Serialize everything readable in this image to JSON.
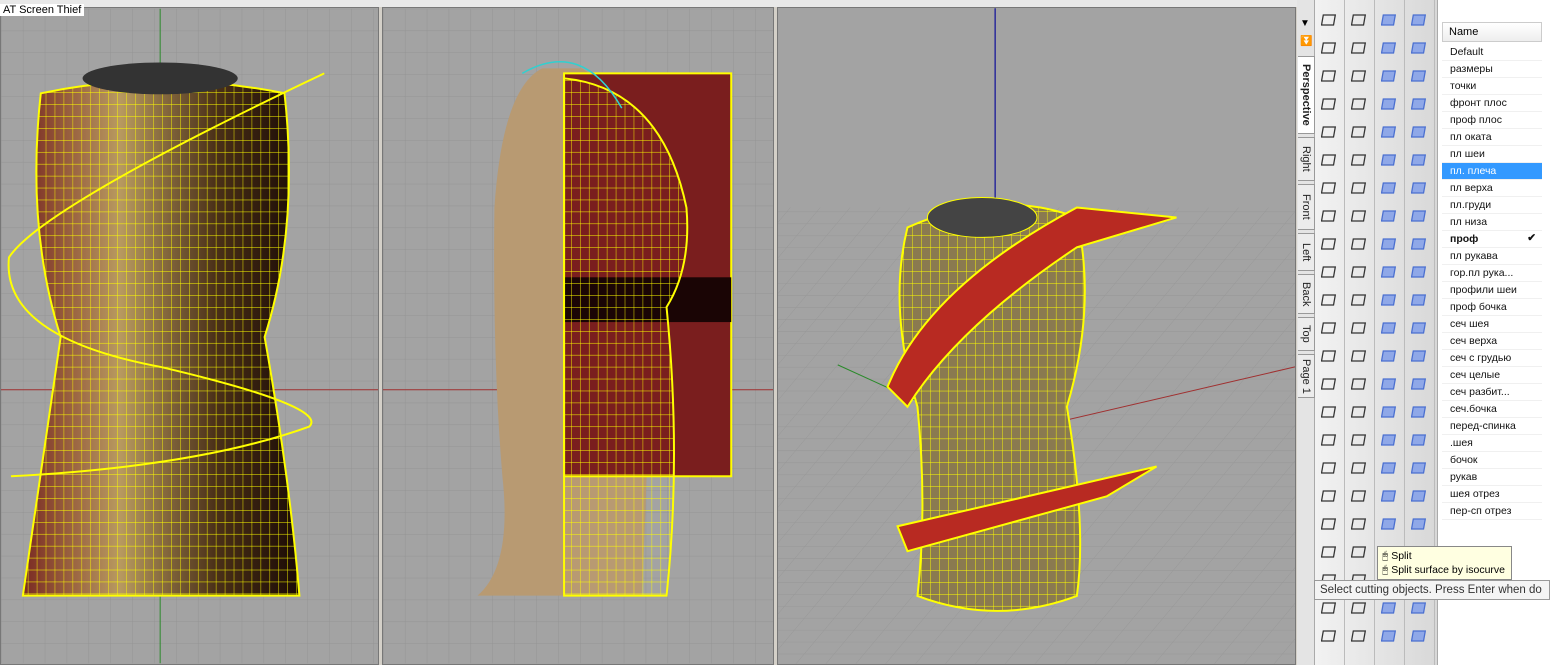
{
  "app_title": "AT Screen Thief",
  "viewport_tabs": [
    "Perspective",
    "Right",
    "Front",
    "Left",
    "Back",
    "Top",
    "Page 1"
  ],
  "active_tab": "Perspective",
  "layers": {
    "header": "Name",
    "items": [
      "Default",
      "размеры",
      "точки",
      "фронт плос",
      "проф  плос",
      "пл оката",
      "пл шеи",
      "пл. плеча",
      "пл верха",
      "пл.груди",
      "пл низа",
      "проф",
      "пл рукава",
      "гор.пл рука...",
      "профили шеи",
      "проф  бочка",
      "сеч  шея",
      "сеч верха",
      "сеч с грудью",
      "сеч  целые",
      "сеч  разбит...",
      "сеч.бочка",
      "перед-спинка",
      ".шея",
      "бочок",
      "рукав",
      "шея отрез",
      "пер-сп отрез"
    ],
    "selected": "пл. плеча",
    "current": "проф",
    "check": "✔"
  },
  "tooltip": {
    "left_click": "Split",
    "right_click": "Split surface by isocurve"
  },
  "status_prompt": "Select cutting objects. Press Enter when do",
  "colors": {
    "viewport_bg": "#a3a3a3",
    "wire": "#ffff00",
    "surface": "#9b2a25",
    "selection": "#3399ff"
  }
}
